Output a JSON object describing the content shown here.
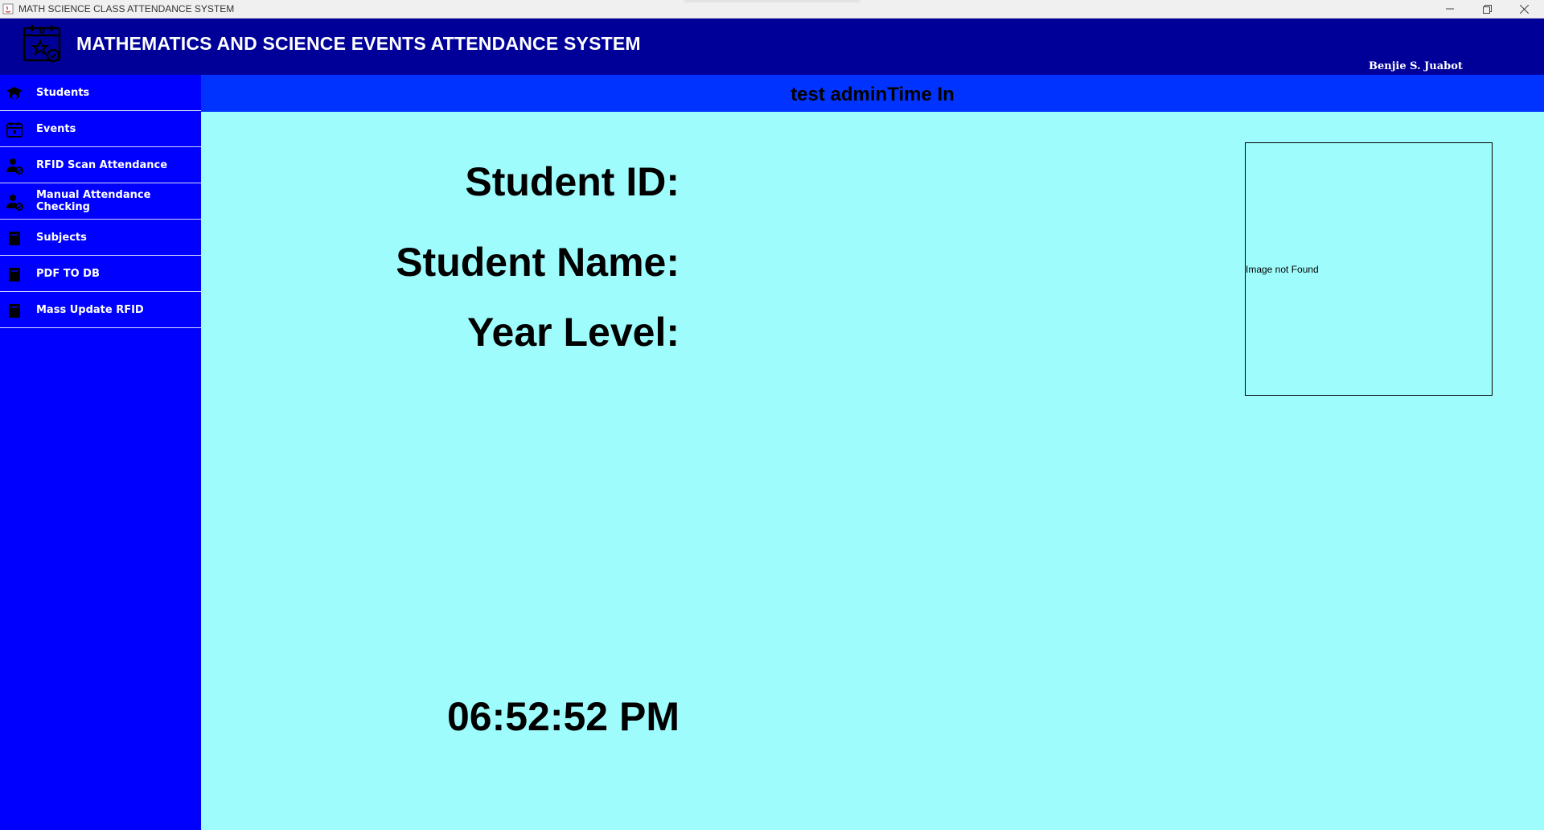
{
  "window": {
    "title": "MATH SCIENCE CLASS ATTENDANCE SYSTEM"
  },
  "header": {
    "title": "MATHEMATICS AND SCIENCE EVENTS ATTENDANCE SYSTEM",
    "user": "Benjie S. Juabot"
  },
  "sidebar": {
    "items": [
      {
        "label": "Students",
        "icon": "graduation-cap-icon"
      },
      {
        "label": "Events",
        "icon": "calendar-icon"
      },
      {
        "label": "RFID Scan Attendance",
        "icon": "user-check-icon"
      },
      {
        "label": "Manual Attendance Checking",
        "icon": "user-check-icon"
      },
      {
        "label": "Subjects",
        "icon": "book-icon"
      },
      {
        "label": "PDF TO DB",
        "icon": "book-icon"
      },
      {
        "label": "Mass Update RFID",
        "icon": "book-icon"
      }
    ]
  },
  "main": {
    "banner": "test adminTime In",
    "student_id_label": "Student ID:",
    "student_name_label": "Student Name:",
    "year_level_label": "Year Level:",
    "clock": "06:52:52 PM",
    "photo_placeholder": "Image not Found"
  },
  "colors": {
    "header_bg": "#000099",
    "sidebar_bg": "#0000ff",
    "banner_bg": "#0033ff",
    "main_bg": "#9ffcfd"
  }
}
